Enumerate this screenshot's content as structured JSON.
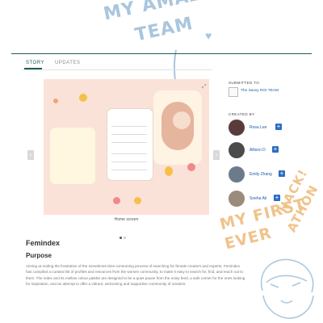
{
  "doodles": {
    "line1": "MY AMAZING",
    "line2": "TEAM",
    "first": "MY FIRST-",
    "ever": "EVER",
    "hack": "HACK!",
    "athon": "ATHON",
    "blue": "#a9c6dd",
    "orange": "#f0c38a"
  },
  "tabs": [
    "STORY",
    "UPDATES"
  ],
  "gallery": {
    "caption": "Home screen",
    "slide_count": 2,
    "active_slide": 1,
    "background": "#fbe2d8"
  },
  "project": {
    "title": "Femindex",
    "section": "Purpose",
    "body": "Aiming at ending the frustration of the sometimes-time-consuming process of searching for female creators and experts, Femindex has compiled a curated list of profiles and resources from the women community, to make it easy to search for, find, and reach out to them. The index and its mellow colour palette are designed to be a quiet pause from the noisy feed, a safe corner for the ones looking for inspiration, and an attempt to offer a vibrant, welcoming and supportive community of creators."
  },
  "sidebar": {
    "submitted_heading": "SUBMITTED TO",
    "submitted_to": "The Savvy ROI TEAM",
    "created_heading": "CREATED BY",
    "members": [
      {
        "name": "Rosa Lee",
        "avatar_color": "#5a3b3b"
      },
      {
        "name": "Allison D",
        "avatar_color": "#4b4b4b"
      },
      {
        "name": "Emily Zhang",
        "avatar_color": "#6b7b8c"
      },
      {
        "name": "Sneha Ali",
        "avatar_color": "#9a8b7a"
      }
    ]
  },
  "colors": {
    "accent": "#1f5f57",
    "link": "#1a5aa8",
    "plus": "#2b6cc4"
  }
}
